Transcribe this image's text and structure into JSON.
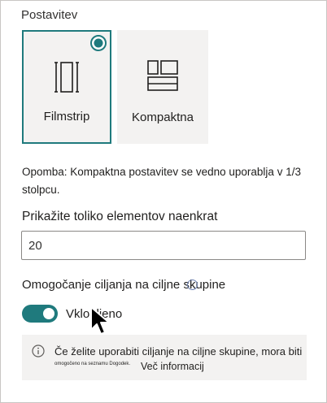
{
  "layout": {
    "section_label": "Postavitev",
    "options": [
      {
        "label": "Filmstrip",
        "selected": true,
        "icon": "filmstrip-icon"
      },
      {
        "label": "Kompaktna",
        "selected": false,
        "icon": "compact-grid-icon"
      }
    ],
    "accent_color": "#1f7a7d"
  },
  "note": "Opomba: Kompaktna postavitev se vedno uporablja v 1/3 stolpcu.",
  "item_count": {
    "label": "Prikažite toliko elementov naenkrat",
    "value": "20"
  },
  "audience_targeting": {
    "label": "Omogočanje ciljanja na ciljne skupine",
    "toggle_on": true,
    "toggle_text": "Vklopljeno"
  },
  "info": {
    "text": "Če želite uporabiti ciljanje na ciljne skupine, mora biti",
    "small_text": "omogočeno na seznamu Dogodek.",
    "link": "Več informacij",
    "icon": "info-icon"
  }
}
